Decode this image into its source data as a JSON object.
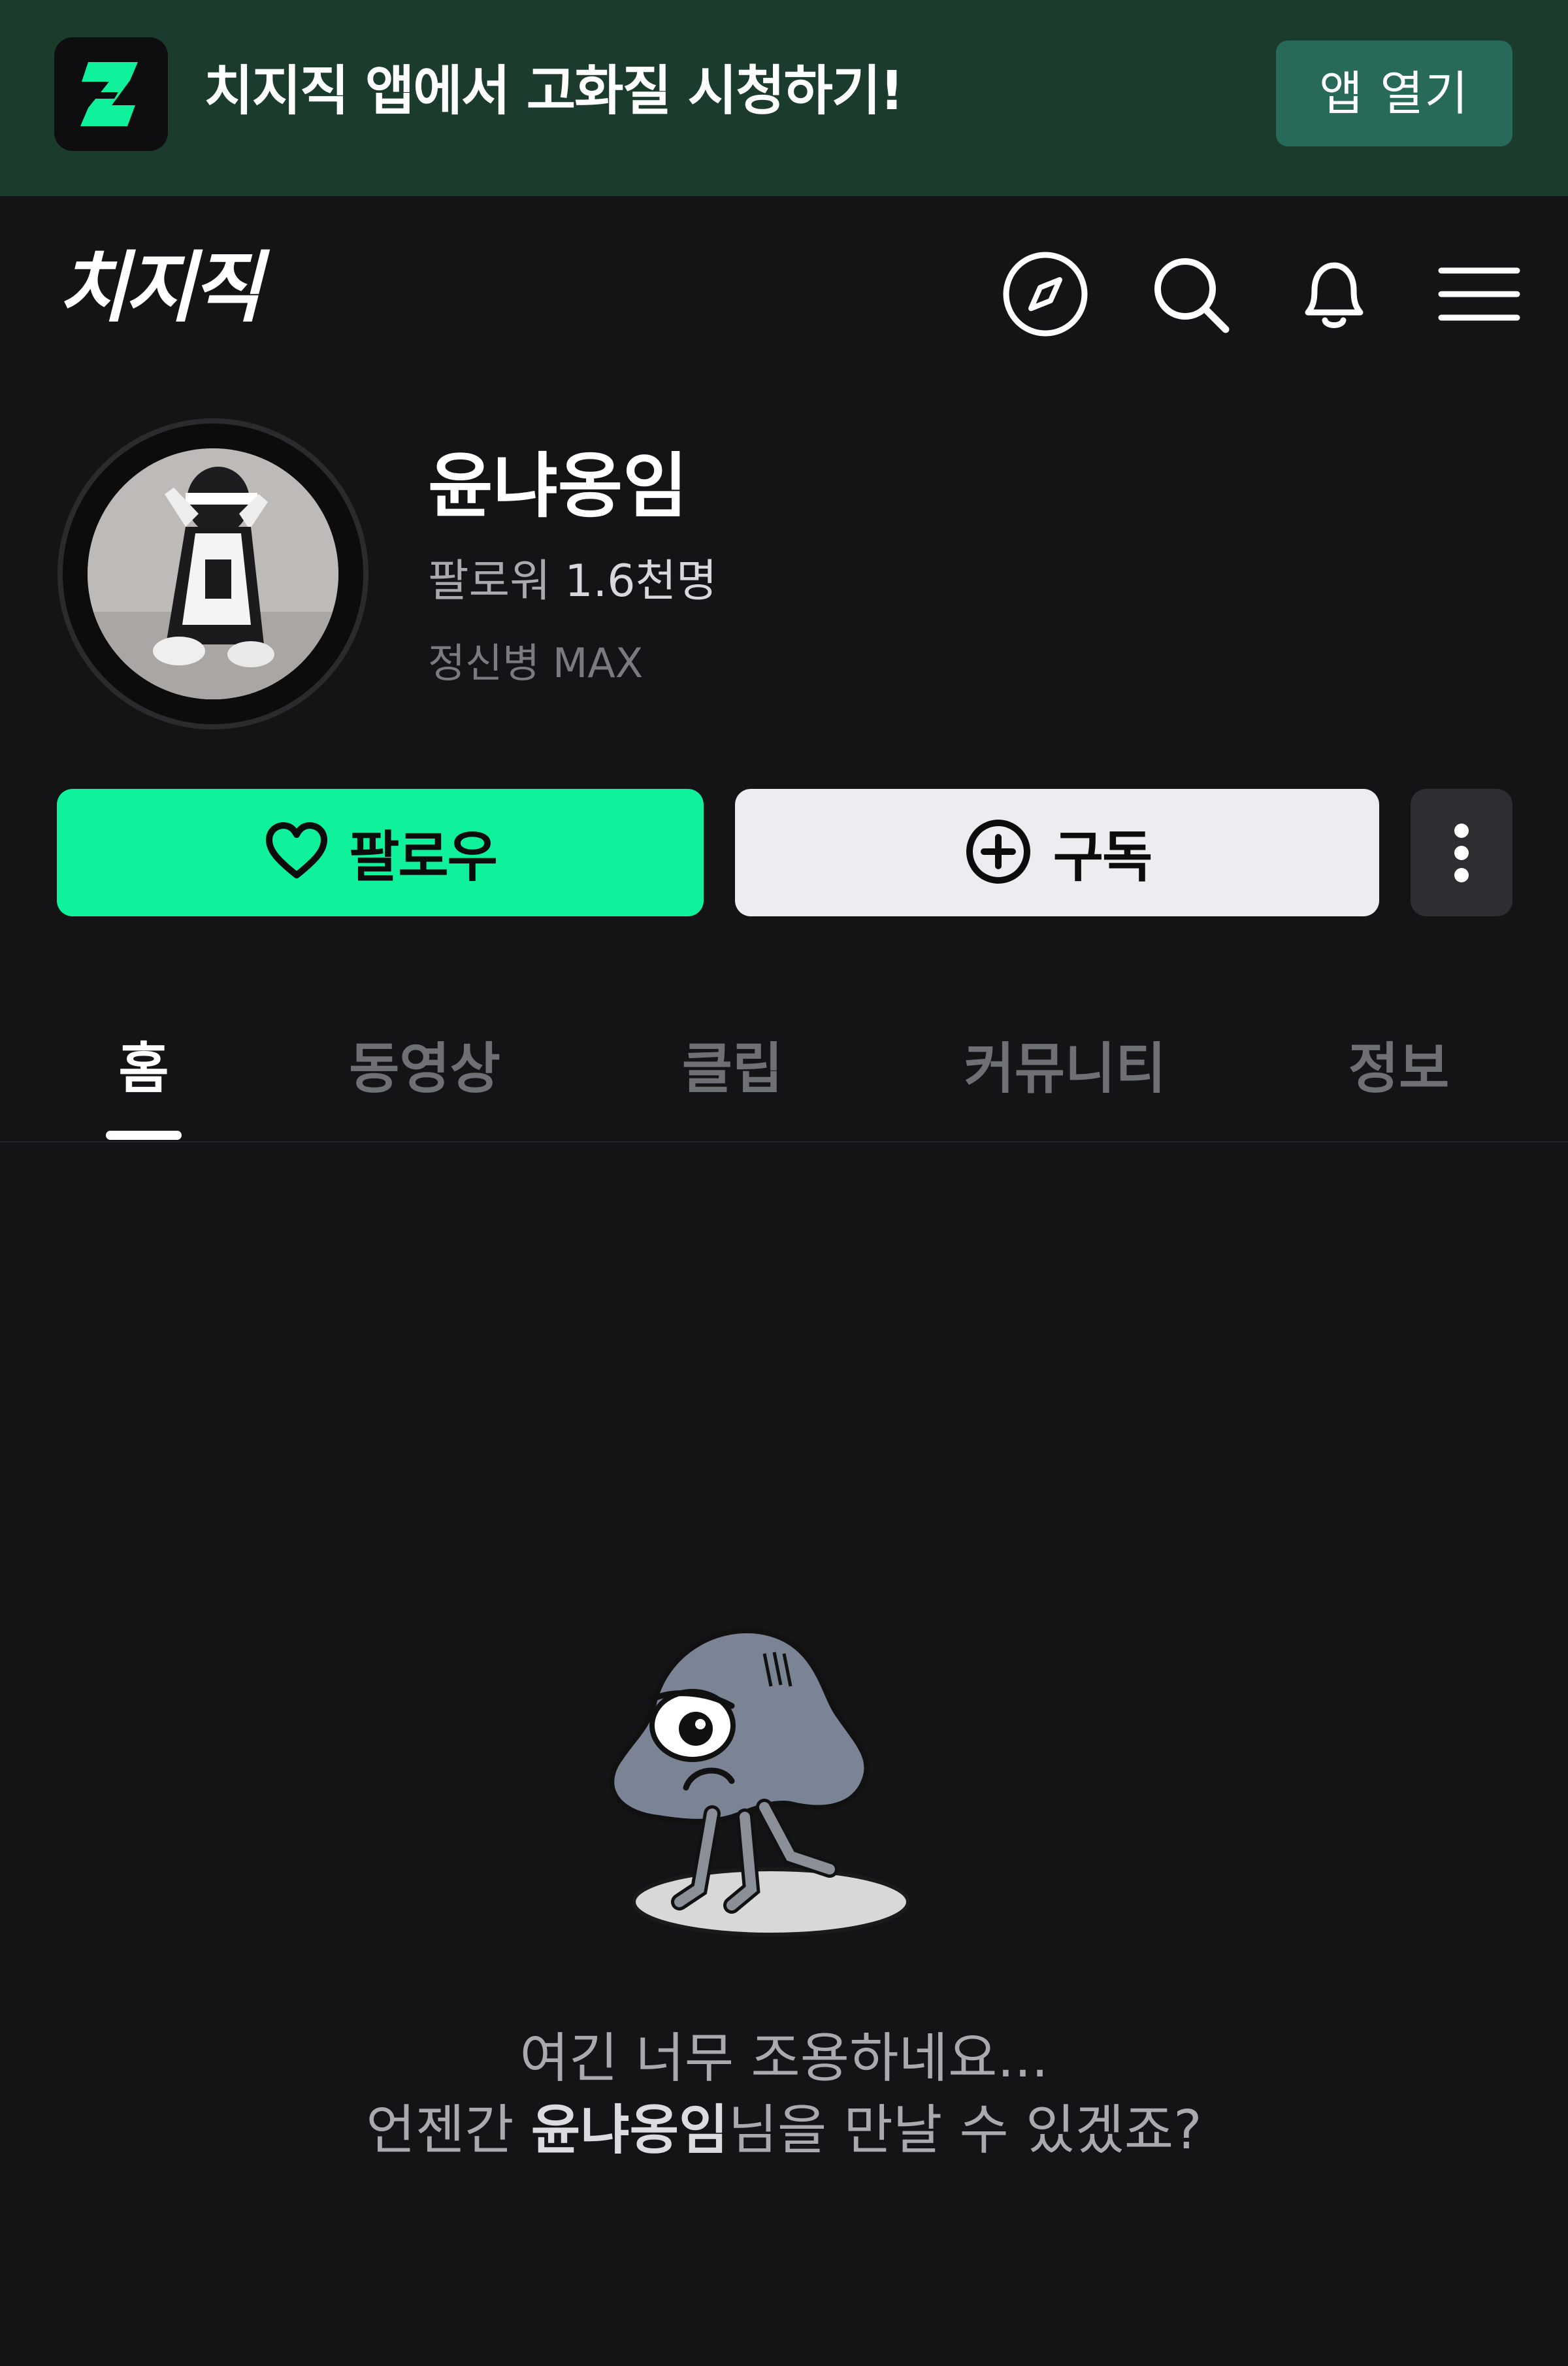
{
  "banner": {
    "text": "치지직 앱에서 고화질 시청하기!",
    "open_button": "앱 열기",
    "logo_icon": "chzzk-z-logo-icon",
    "accent": "#10f19c"
  },
  "header": {
    "brand": "치지직",
    "icons": [
      "compass-icon",
      "search-icon",
      "bell-icon",
      "menu-icon"
    ]
  },
  "profile": {
    "name": "윤냐옹임",
    "followers_label": "팔로워",
    "followers_count": "1.6천명",
    "bio": "정신병 MAX"
  },
  "actions": {
    "follow_label": "팔로우",
    "subscribe_label": "구독",
    "more_icon": "more-vertical-icon"
  },
  "tabs": [
    {
      "label": "홈",
      "active": true
    },
    {
      "label": "동영상",
      "active": false
    },
    {
      "label": "클립",
      "active": false
    },
    {
      "label": "커뮤니티",
      "active": false
    },
    {
      "label": "정보",
      "active": false
    }
  ],
  "empty_state": {
    "line1": "여긴 너무 조용하네요...",
    "line2_prefix": "언젠간 ",
    "line2_name": "윤냐옹임",
    "line2_suffix": "님을 만날 수 있겠죠?"
  },
  "colors": {
    "background": "#141416",
    "banner_bg": "#1b3b2d",
    "follow_button": "#10f19c",
    "subscribe_button": "#ececf1"
  }
}
